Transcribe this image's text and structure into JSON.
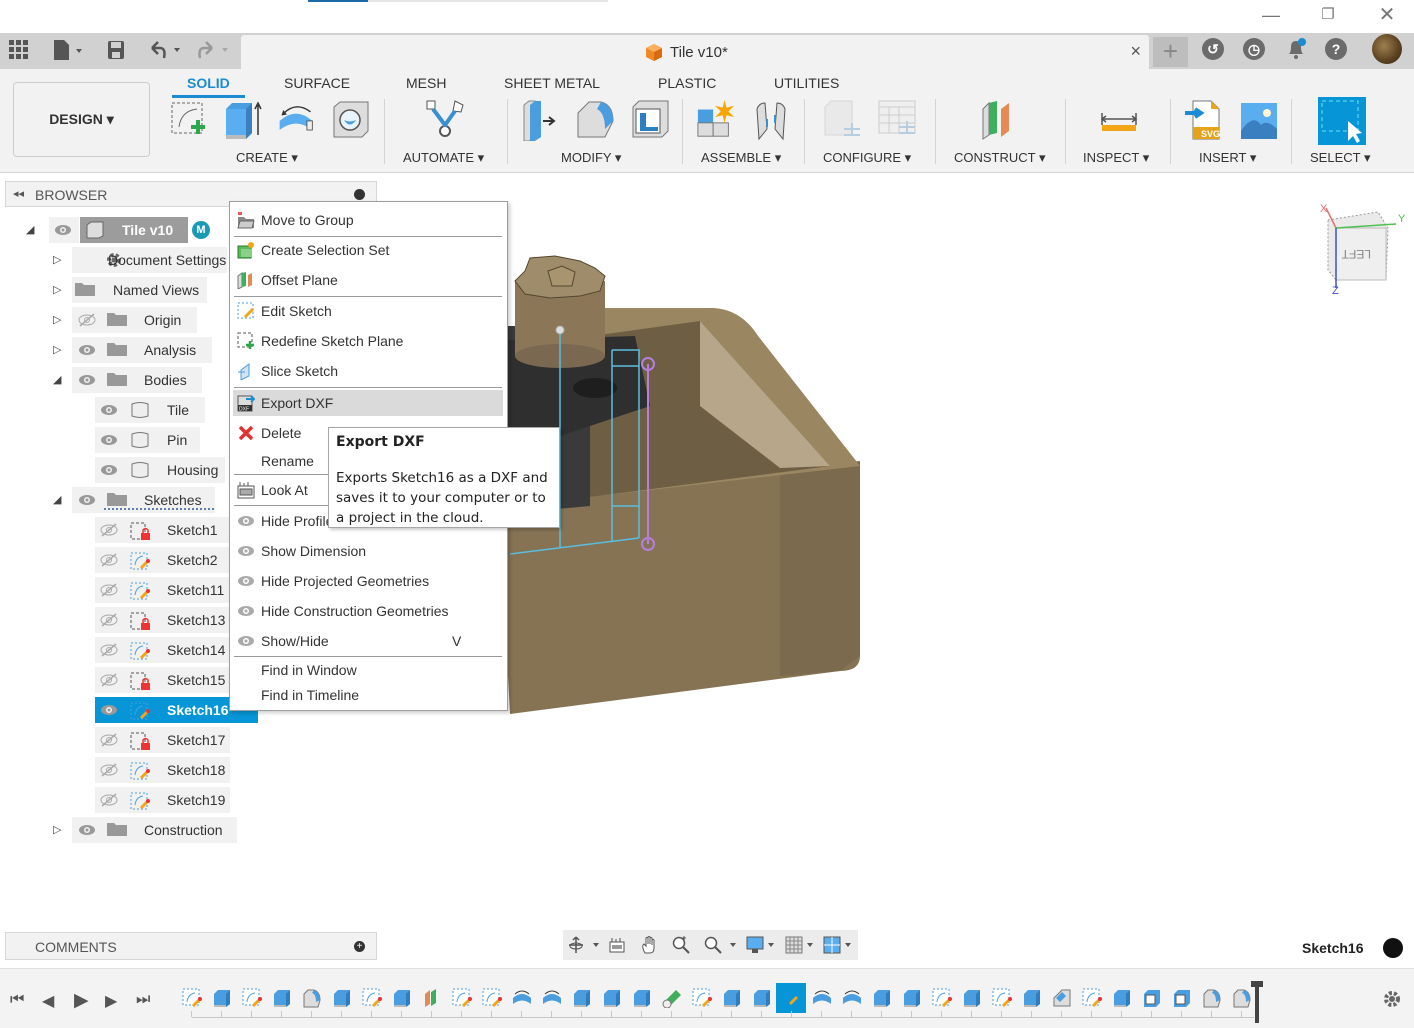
{
  "window": {
    "minimize_icon": "minimize-icon",
    "restore_icon": "restore-icon",
    "close_icon": "close-icon"
  },
  "quick_access": {
    "data_panel_icon": "grid-icon",
    "file_icon": "file-icon",
    "save_icon": "save-icon",
    "undo_icon": "undo-icon",
    "redo_icon": "redo-icon"
  },
  "doc_tab": {
    "title": "Tile v10*",
    "close": "×",
    "new_tab": "+"
  },
  "top_right": {
    "icons": [
      "extensions-icon",
      "job-status-icon",
      "notifications-icon",
      "help-icon",
      "user-avatar"
    ],
    "help_glyph": "?",
    "notification_badge_color": "#1d8bd1"
  },
  "ribbon": {
    "workspace": "DESIGN",
    "tabs": [
      {
        "label": "SOLID",
        "active": true
      },
      {
        "label": "SURFACE",
        "active": false
      },
      {
        "label": "MESH",
        "active": false
      },
      {
        "label": "SHEET METAL",
        "active": false
      },
      {
        "label": "PLASTIC",
        "active": false
      },
      {
        "label": "UTILITIES",
        "active": false
      }
    ],
    "groups": [
      {
        "label": "CREATE ▾",
        "tools": [
          "create-sketch",
          "extrude",
          "revolve",
          "hole"
        ]
      },
      {
        "label": "AUTOMATE ▾",
        "tools": [
          "automated-modeling"
        ]
      },
      {
        "label": "MODIFY ▾",
        "tools": [
          "press-pull",
          "fillet",
          "shell"
        ]
      },
      {
        "label": "ASSEMBLE ▾",
        "tools": [
          "new-component",
          "joint"
        ]
      },
      {
        "label": "CONFIGURE ▾",
        "tools": [
          "configure-model",
          "configuration-table"
        ]
      },
      {
        "label": "CONSTRUCT ▾",
        "tools": [
          "offset-plane"
        ]
      },
      {
        "label": "INSPECT ▾",
        "tools": [
          "measure"
        ]
      },
      {
        "label": "INSERT ▾",
        "tools": [
          "insert-svg",
          "canvas"
        ]
      },
      {
        "label": "SELECT ▾",
        "tools": [
          "select"
        ]
      }
    ],
    "accent": "#1d8bd1"
  },
  "browser": {
    "title": "BROWSER",
    "root": "Tile v10",
    "items": [
      {
        "label": "Document Settings",
        "icon": "gear-icon",
        "expander": "▷"
      },
      {
        "label": "Named Views",
        "icon": "folder-icon",
        "expander": "▷"
      },
      {
        "label": "Origin",
        "icon": "folder-icon",
        "expander": "▷",
        "visible": false
      },
      {
        "label": "Analysis",
        "icon": "folder-icon",
        "expander": "▷",
        "visible": true
      },
      {
        "label": "Bodies",
        "icon": "folder-icon",
        "expander": "◢",
        "visible": true
      },
      {
        "label": "Tile",
        "icon": "body-icon",
        "visible": true
      },
      {
        "label": "Pin",
        "icon": "body-icon",
        "visible": true
      },
      {
        "label": "Housing",
        "icon": "body-icon",
        "visible": true
      },
      {
        "label": "Sketches",
        "icon": "folder-icon",
        "expander": "◢",
        "visible": true
      },
      {
        "label": "Sketch1",
        "icon": "locked-sketch-icon",
        "visible": false
      },
      {
        "label": "Sketch2",
        "icon": "sketch-icon",
        "visible": false
      },
      {
        "label": "Sketch11",
        "icon": "sketch-icon",
        "visible": false
      },
      {
        "label": "Sketch13",
        "icon": "locked-sketch-icon",
        "visible": false
      },
      {
        "label": "Sketch14",
        "icon": "sketch-icon",
        "visible": false
      },
      {
        "label": "Sketch15",
        "icon": "locked-sketch-icon",
        "visible": false
      },
      {
        "label": "Sketch16",
        "icon": "sketch-icon",
        "visible": true,
        "selected": true
      },
      {
        "label": "Sketch17",
        "icon": "locked-sketch-icon",
        "visible": false
      },
      {
        "label": "Sketch18",
        "icon": "sketch-icon",
        "visible": false
      },
      {
        "label": "Sketch19",
        "icon": "sketch-icon",
        "visible": false
      },
      {
        "label": "Construction",
        "icon": "folder-icon",
        "expander": "▷",
        "visible": true
      }
    ]
  },
  "context_menu": {
    "items": [
      {
        "label": "Move to Group",
        "icon": "move-to-group-icon"
      },
      {
        "label": "Create Selection Set",
        "icon": "selection-set-icon"
      },
      {
        "label": "Offset Plane",
        "icon": "offset-plane-icon"
      },
      {
        "label": "Edit Sketch",
        "icon": "edit-sketch-icon"
      },
      {
        "label": "Redefine Sketch Plane",
        "icon": "redefine-plane-icon"
      },
      {
        "label": "Slice Sketch",
        "icon": "slice-icon"
      },
      {
        "label": "Export DXF",
        "icon": "dxf-icon",
        "highlighted": true
      },
      {
        "label": "Delete",
        "icon": "delete-icon"
      },
      {
        "label": "Rename",
        "icon": ""
      },
      {
        "label": "Look At",
        "icon": "look-at-icon"
      },
      {
        "label": "Hide Profile",
        "icon": "eye-icon"
      },
      {
        "label": "Show Dimension",
        "icon": "eye-icon"
      },
      {
        "label": "Hide Projected Geometries",
        "icon": "eye-icon"
      },
      {
        "label": "Hide Construction Geometries",
        "icon": "eye-icon"
      },
      {
        "label": "Show/Hide",
        "icon": "eye-icon",
        "shortcut": "V"
      },
      {
        "label": "Find in Window",
        "icon": ""
      },
      {
        "label": "Find in Timeline",
        "icon": ""
      }
    ]
  },
  "tooltip": {
    "title": "Export DXF",
    "description": "Exports Sketch16 as a DXF and saves it to your computer or to a project in the cloud."
  },
  "viewcube": {
    "face": "LEFT",
    "axes": [
      "X",
      "Y",
      "Z"
    ]
  },
  "comments": {
    "title": "COMMENTS"
  },
  "nav_toolbar": {
    "tools": [
      "orbit-icon",
      "look-at-icon",
      "pan-icon",
      "zoom-icon",
      "zoom-window-icon",
      "display-settings-icon",
      "grid-icon",
      "viewports-icon"
    ]
  },
  "status": {
    "active_sketch": "Sketch16"
  },
  "timeline": {
    "controls": [
      "go-to-start",
      "step-back",
      "play",
      "step-forward",
      "go-to-end"
    ],
    "features": [
      "sketch",
      "extrude",
      "sketch",
      "extrude",
      "fillet",
      "extrude",
      "sketch",
      "extrude",
      "plane",
      "sketch",
      "sketch",
      "revolve",
      "revolve",
      "extrude",
      "extrude",
      "extrude",
      "pipe",
      "sketch",
      "extrude",
      "extrude",
      "sketch-active",
      "revolve",
      "revolve",
      "extrude",
      "extrude",
      "sketch",
      "extrude",
      "sketch",
      "extrude",
      "chamfer",
      "sketch",
      "extrude",
      "shell",
      "shell",
      "fillet",
      "fillet"
    ],
    "active_index": 20
  }
}
